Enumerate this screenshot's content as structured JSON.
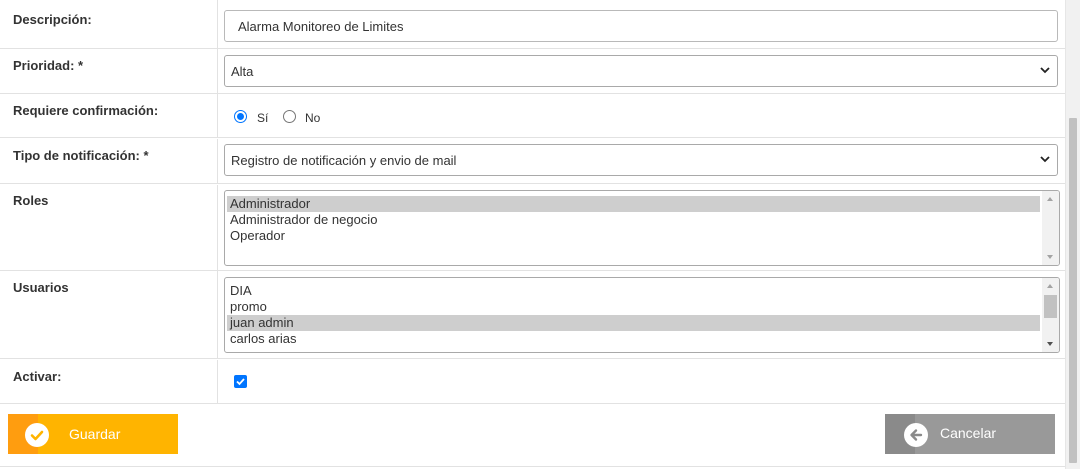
{
  "form": {
    "descripcion": {
      "label": "Descripción:",
      "value": "Alarma Monitoreo de Limites"
    },
    "prioridad": {
      "label": "Prioridad: *",
      "value": "Alta"
    },
    "confirmacion": {
      "label": "Requiere confirmación:",
      "options": [
        {
          "label": "Sí",
          "checked": true
        },
        {
          "label": "No",
          "checked": false
        }
      ]
    },
    "tipo": {
      "label": "Tipo de notificación: *",
      "value": "Registro de notificación y envio de mail"
    },
    "roles": {
      "label": "Roles",
      "options": [
        {
          "label": "Administrador",
          "selected": true
        },
        {
          "label": "Administrador de negocio",
          "selected": false
        },
        {
          "label": "Operador",
          "selected": false
        }
      ]
    },
    "usuarios": {
      "label": "Usuarios",
      "options": [
        {
          "label": "DIA",
          "selected": false
        },
        {
          "label": "promo",
          "selected": false
        },
        {
          "label": "juan admin",
          "selected": true
        },
        {
          "label": "carlos arias",
          "selected": false
        }
      ]
    },
    "activar": {
      "label": "Activar:",
      "checked": true
    }
  },
  "actions": {
    "save_label": "Guardar",
    "cancel_label": "Cancelar"
  },
  "colors": {
    "save": "#ffb400",
    "save_band": "#ff9d0f",
    "cancel": "#999999",
    "accent": "#0075ff"
  }
}
